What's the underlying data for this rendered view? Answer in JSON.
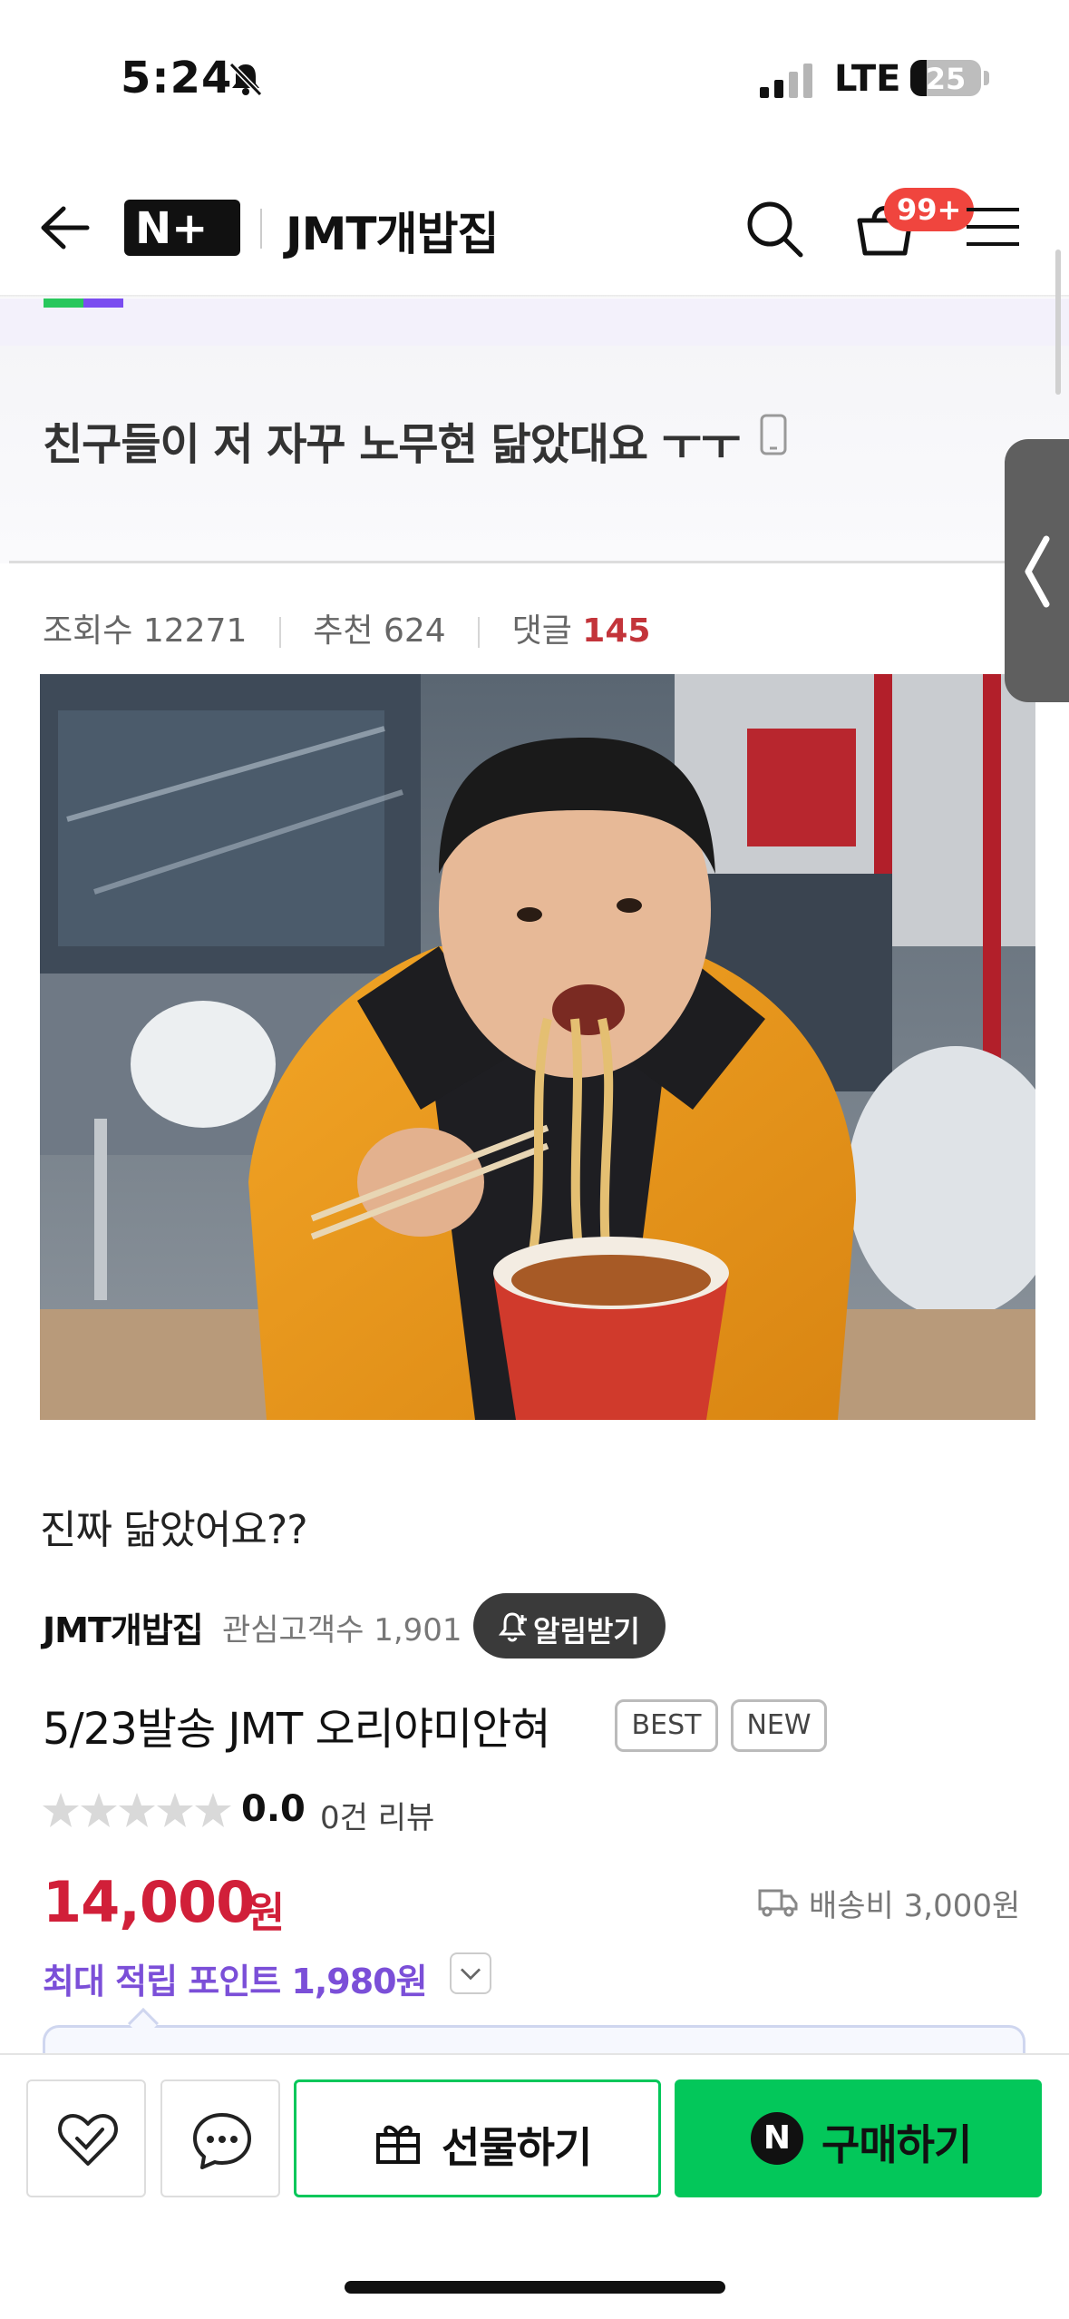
{
  "status_bar": {
    "time": "5:24",
    "network": "LTE",
    "battery": "25"
  },
  "header": {
    "logo": "N+",
    "store_name": "JMT개밥집",
    "cart_badge": "99+"
  },
  "post": {
    "title": "친구들이 저 자꾸 노무현 닮았대요 ㅜㅜ",
    "views_label": "조회수",
    "views": "12271",
    "likes_label": "추천",
    "likes": "624",
    "comments_label": "댓글",
    "comments": "145",
    "caption": "진짜 닮았어요??"
  },
  "seller": {
    "name": "JMT개밥집",
    "followers_label": "관심고객수",
    "followers": "1,901",
    "alert_label": "알림받기"
  },
  "product": {
    "title": "5/23발송 JMT 오리야미안혀",
    "badges": [
      "BEST",
      "NEW"
    ],
    "rating": "0.0",
    "reviews": "0건 리뷰",
    "price": "14,000",
    "currency": "원",
    "shipping": "배송비 3,000원",
    "points": "최대 적립 포인트 1,980원"
  },
  "actions": {
    "gift_label": "선물하기",
    "buy_label": "구매하기",
    "buy_icon": "N"
  },
  "colors": {
    "accent_green": "#03c75a",
    "price_red": "#d11f39",
    "points_purple": "#7b4fd8",
    "badge_red": "#f0453e"
  }
}
